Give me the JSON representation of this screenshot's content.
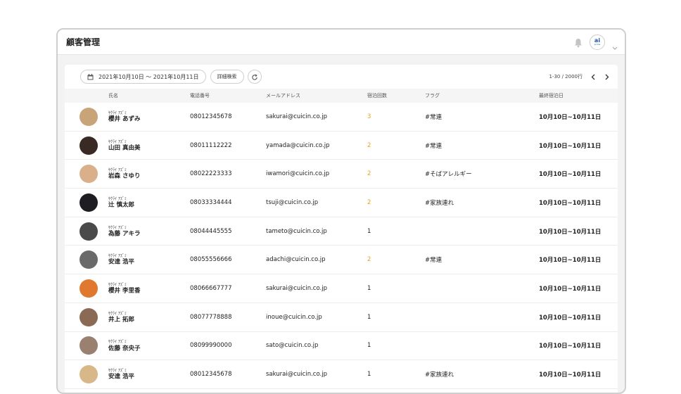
{
  "app": {
    "title": "顧客管理",
    "logo_text": "ai",
    "logo_sub": "prime"
  },
  "toolbar": {
    "date_range": "2021年10月10日 ～ 2021年10月11日",
    "detail_search": "詳細検索",
    "pagination": "1-30 / 2000行"
  },
  "columns": {
    "name": "氏名",
    "phone": "電話番号",
    "email": "メールアドレス",
    "stays": "宿泊回数",
    "flag": "フラグ",
    "last_stay": "最終宿泊日"
  },
  "rows": [
    {
      "kana": "ｻｸﾗｲ ｱｽﾞﾐ",
      "name": "櫻井 あずみ",
      "phone": "08012345678",
      "email": "sakurai@cuicin.co.jp",
      "stays": "3",
      "flag": "#常連",
      "last": "10月10日~10月11日",
      "avatar_color": "#c8a478"
    },
    {
      "kana": "ｻｸﾗｲ ｱｽﾞﾐ",
      "name": "山田 真由美",
      "phone": "08011112222",
      "email": "yamada@cuicin.co.jp",
      "stays": "2",
      "flag": "#常連",
      "last": "10月10日~10月11日",
      "avatar_color": "#3a2a25"
    },
    {
      "kana": "ｻｸﾗｲ ｱｽﾞﾐ",
      "name": "岩森 さゆり",
      "phone": "08022223333",
      "email": "iwamori@cuicin.co.jp",
      "stays": "2",
      "flag": "#そばアレルギー",
      "last": "10月10日~10月11日",
      "avatar_color": "#d9b08a"
    },
    {
      "kana": "ｻｸﾗｲ ｱｽﾞﾐ",
      "name": "辻 慎太郎",
      "phone": "08033334444",
      "email": "tsuji@cuicin.co.jp",
      "stays": "2",
      "flag": "#家族連れ",
      "last": "10月10日~10月11日",
      "avatar_color": "#1e1e22"
    },
    {
      "kana": "ｻｸﾗｲ ｱｽﾞﾐ",
      "name": "為藤 アキラ",
      "phone": "08044445555",
      "email": "tameto@cuicin.co.jp",
      "stays": "1",
      "flag": "",
      "last": "10月10日~10月11日",
      "avatar_color": "#4a4a4a"
    },
    {
      "kana": "ｻｸﾗｲ ｱｽﾞﾐ",
      "name": "安達 浩平",
      "phone": "08055556666",
      "email": "adachi@cuicin.co.jp",
      "stays": "2",
      "flag": "#常連",
      "last": "10月10日~10月11日",
      "avatar_color": "#6a6a6a"
    },
    {
      "kana": "ｻｸﾗｲ ｱｽﾞﾐ",
      "name": "櫻井 李里香",
      "phone": "08066667777",
      "email": "sakurai@cuicin.co.jp",
      "stays": "1",
      "flag": "",
      "last": "10月10日~10月11日",
      "avatar_color": "#e07830"
    },
    {
      "kana": "ｻｸﾗｲ ｱｽﾞﾐ",
      "name": "井上 拓郎",
      "phone": "08077778888",
      "email": "inoue@cuicin.co.jp",
      "stays": "1",
      "flag": "",
      "last": "10月10日~10月11日",
      "avatar_color": "#8a6a55"
    },
    {
      "kana": "ｻｸﾗｲ ｱｽﾞﾐ",
      "name": "佐藤 奈央子",
      "phone": "08099990000",
      "email": "sato@cuicin.co.jp",
      "stays": "1",
      "flag": "",
      "last": "10月10日~10月11日",
      "avatar_color": "#9a8070"
    },
    {
      "kana": "ｻｸﾗｲ ｱｽﾞﾐ",
      "name": "安達 浩平",
      "phone": "08012345678",
      "email": "sakurai@cuicin.co.jp",
      "stays": "1",
      "flag": "#家族連れ",
      "last": "10月10日~10月11日",
      "avatar_color": "#d8b888"
    }
  ],
  "colors": {
    "stays_highlight": "#e8a21a",
    "accent": "#1a56b0"
  },
  "icons": [
    "bell-icon",
    "chevron-down-icon",
    "calendar-icon",
    "refresh-icon",
    "chevron-left-icon",
    "chevron-right-icon"
  ]
}
